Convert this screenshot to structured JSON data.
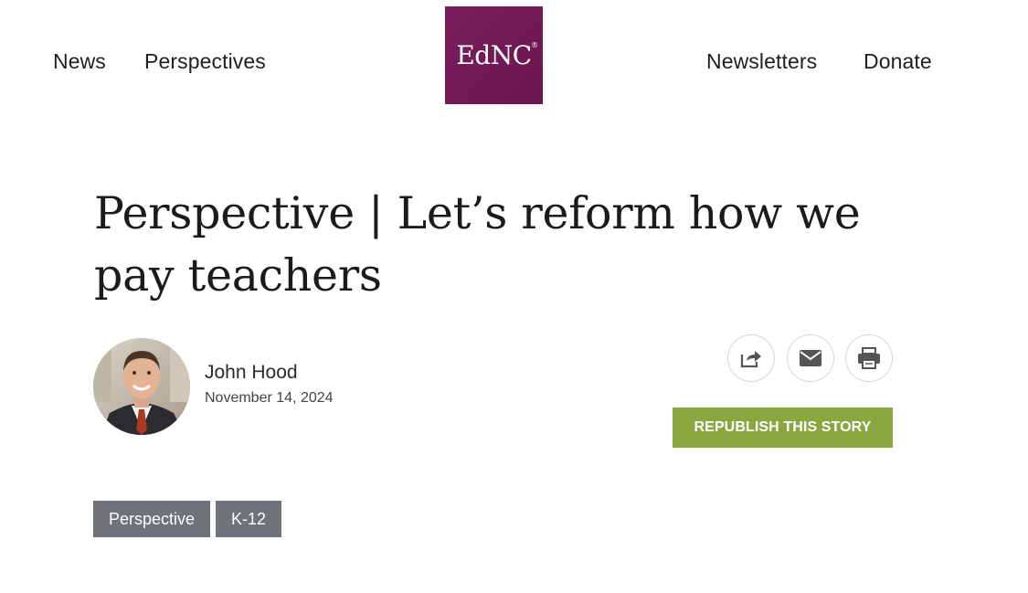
{
  "header": {
    "nav_left": [
      "News",
      "Perspectives"
    ],
    "nav_right": [
      "Newsletters",
      "Donate"
    ],
    "logo": {
      "text": "EdNC",
      "mark": "®",
      "bg_color": "#731a56"
    }
  },
  "article": {
    "title": "Perspective | Let’s reform how we pay teachers",
    "author": {
      "name": "John Hood",
      "date": "November 14, 2024",
      "avatar_icon": "author-photo"
    },
    "share": {
      "icons": [
        "share-icon",
        "email-icon",
        "print-icon"
      ]
    },
    "republish_label": "REPUBLISH THIS STORY",
    "republish_color": "#8ba53f",
    "tags": [
      "Perspective",
      "K-12"
    ],
    "tag_color": "#6f7278"
  }
}
